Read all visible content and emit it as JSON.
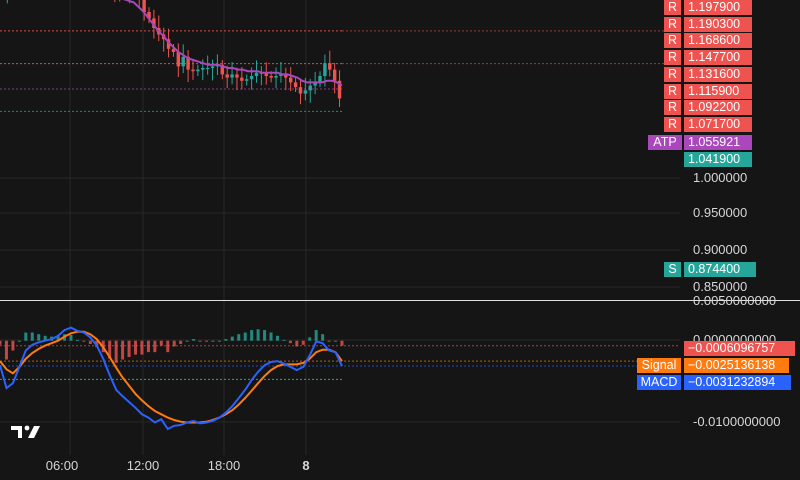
{
  "colors": {
    "background": "#151515",
    "resistance": "#ef5350",
    "support": "#26a69a",
    "atp": "#ab47bc",
    "macd": "#2962ff",
    "signal": "#ff7b0f",
    "up": "#26a69a",
    "down": "#ef5350"
  },
  "chart_data": [
    {
      "type": "candlestick",
      "name_label": "",
      "y_ticks": [
        "1.000000",
        "0.950000",
        "0.900000",
        "0.850000"
      ],
      "x_ticks": [
        "06:00",
        "12:00",
        "18:00",
        "8"
      ],
      "ylim": [
        0.84,
        1.2
      ],
      "resistance_levels": [
        1.1979,
        1.1903,
        1.1686,
        1.1477,
        1.1316,
        1.1159,
        1.0922,
        1.0717
      ],
      "resistance_labels": [
        "1.197900",
        "1.190300",
        "1.168600",
        "1.147700",
        "1.131600",
        "1.115900",
        "1.092200",
        "1.071700"
      ],
      "resistance_tag": "R",
      "support_level": 0.8744,
      "support_label": "0.874400",
      "support_tag": "S",
      "atp_tag": "ATP",
      "atp_value": "1.055921",
      "last_price": "1.041900",
      "close": [
        1.116,
        1.119,
        1.121,
        1.126,
        1.131,
        1.138,
        1.137,
        1.14,
        1.138,
        1.134,
        1.136,
        1.135,
        1.138,
        1.14,
        1.137,
        1.138,
        1.136,
        1.135,
        1.131,
        1.128,
        1.122,
        1.119,
        1.121,
        1.118,
        1.116,
        1.116,
        1.121,
        1.118,
        1.115,
        1.104,
        1.1,
        1.094,
        1.09,
        1.087,
        1.081,
        1.079,
        1.07,
        1.076,
        1.068,
        1.067,
        1.068,
        1.069,
        1.069,
        1.07,
        1.071,
        1.065,
        1.063,
        1.065,
        1.063,
        1.061,
        1.062,
        1.064,
        1.066,
        1.066,
        1.064,
        1.063,
        1.064,
        1.065,
        1.063,
        1.06,
        1.057,
        1.053,
        1.055,
        1.058,
        1.06,
        1.064,
        1.072,
        1.068,
        1.061,
        1.05
      ],
      "atp_line": [
        1.122,
        1.124,
        1.126,
        1.128,
        1.129,
        1.13,
        1.131,
        1.131,
        1.132,
        1.132,
        1.131,
        1.131,
        1.131,
        1.13,
        1.129,
        1.128,
        1.126,
        1.124,
        1.123,
        1.122,
        1.12,
        1.118,
        1.117,
        1.115,
        1.114,
        1.112,
        1.111,
        1.11,
        1.107,
        1.104,
        1.1,
        1.096,
        1.092,
        1.089,
        1.085,
        1.082,
        1.079,
        1.077,
        1.075,
        1.074,
        1.073,
        1.072,
        1.071,
        1.071,
        1.071,
        1.07,
        1.069,
        1.069,
        1.068,
        1.068,
        1.067,
        1.067,
        1.067,
        1.066,
        1.066,
        1.066,
        1.066,
        1.065,
        1.065,
        1.064,
        1.063,
        1.061,
        1.06,
        1.06,
        1.06,
        1.06,
        1.061,
        1.061,
        1.06,
        1.058
      ]
    },
    {
      "type": "macd",
      "y_ticks": [
        "0.0050000000",
        "0.0000000000",
        "-0.0100000000"
      ],
      "ylim": [
        -0.0125,
        0.005
      ],
      "histogram_label": "−0.0006096757",
      "signal_name": "Signal",
      "signal_value": "−0.0025136138",
      "macd_name": "MACD",
      "macd_value": "−0.0031232894",
      "macd": [
        -0.003,
        -0.0058,
        -0.0052,
        -0.0032,
        -0.0012,
        -0.0005,
        -0.0002,
        0.0,
        0.0002,
        0.0006,
        0.0013,
        0.0016,
        0.0012,
        0.001,
        0.0004,
        -0.0006,
        -0.0022,
        -0.0042,
        -0.006,
        -0.0068,
        -0.0075,
        -0.0082,
        -0.009,
        -0.0094,
        -0.01,
        -0.0096,
        -0.0108,
        -0.0104,
        -0.0103,
        -0.01,
        -0.0098,
        -0.0101,
        -0.01,
        -0.0098,
        -0.0094,
        -0.0088,
        -0.008,
        -0.007,
        -0.006,
        -0.0048,
        -0.0038,
        -0.003,
        -0.0026,
        -0.0025,
        -0.0028,
        -0.0032,
        -0.0036,
        -0.0032,
        -0.0018,
        -0.0001,
        -0.0003,
        -0.0012,
        -0.0014,
        -0.0031
      ],
      "signal": [
        -0.0025,
        -0.0035,
        -0.004,
        -0.0032,
        -0.0022,
        -0.0015,
        -0.001,
        -0.0006,
        -0.0003,
        0.0,
        0.0005,
        0.0009,
        0.0011,
        0.0011,
        0.0008,
        0.0002,
        -0.0008,
        -0.002,
        -0.0033,
        -0.0045,
        -0.0055,
        -0.0065,
        -0.0073,
        -0.008,
        -0.0086,
        -0.009,
        -0.0094,
        -0.0097,
        -0.0099,
        -0.01,
        -0.01,
        -0.01,
        -0.0099,
        -0.0097,
        -0.0094,
        -0.009,
        -0.0085,
        -0.0078,
        -0.007,
        -0.0061,
        -0.0052,
        -0.0043,
        -0.0036,
        -0.0031,
        -0.0029,
        -0.0029,
        -0.0029,
        -0.0027,
        -0.0022,
        -0.0014,
        -0.0011,
        -0.0011,
        -0.0014,
        -0.0025
      ]
    }
  ]
}
